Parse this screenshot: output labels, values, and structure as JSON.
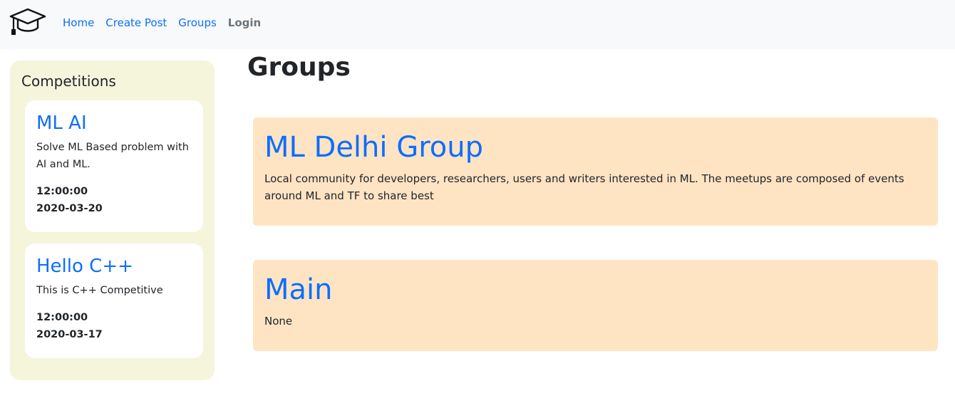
{
  "navbar": {
    "links": [
      "Home",
      "Create Post",
      "Groups",
      "Login"
    ]
  },
  "sidebar": {
    "title": "Competitions",
    "competitions": [
      {
        "title": "ML AI",
        "description": "Solve ML Based problem with AI and ML.",
        "time": "12:00:00",
        "date": "2020-03-20"
      },
      {
        "title": "Hello C++",
        "description": "This is C++ Competitive",
        "time": "12:00:00",
        "date": "2020-03-17"
      }
    ]
  },
  "main": {
    "title": "Groups",
    "groups": [
      {
        "title": "ML Delhi Group",
        "description": "Local community for developers, researchers, users and writers interested in ML. The meetups are composed of events around ML and TF to share best"
      },
      {
        "title": "Main",
        "description": "None"
      }
    ]
  },
  "colors": {
    "link": "#0d6efd",
    "navbar_bg": "#f8f9fa",
    "sidebar_bg": "#f5f5dc",
    "group_card_bg": "#ffe4c4"
  }
}
